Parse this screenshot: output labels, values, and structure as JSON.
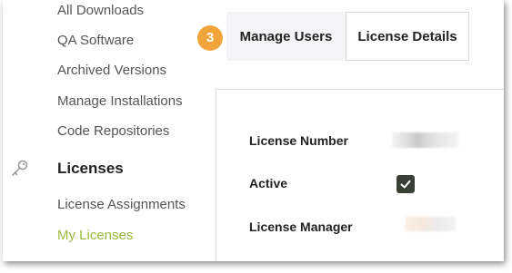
{
  "sidebar": {
    "items": [
      {
        "label": "All Downloads"
      },
      {
        "label": "QA Software"
      },
      {
        "label": "Archived Versions"
      },
      {
        "label": "Manage Installations"
      },
      {
        "label": "Code Repositories"
      }
    ],
    "section": {
      "label": "Licenses",
      "icon": "key-icon"
    },
    "sub_items": [
      {
        "label": "License Assignments"
      },
      {
        "label": "My Licenses",
        "active": true
      }
    ]
  },
  "tabs": {
    "step_number": "3",
    "manage_users": "Manage Users",
    "license_details": "License Details"
  },
  "details": {
    "license_number_label": "License Number",
    "active_label": "Active",
    "active_checked": true,
    "license_manager_label": "License Manager"
  },
  "colors": {
    "accent_active": "#9ab93a",
    "step_badge": "#f0a43a",
    "checkbox_fill": "#3a3f35"
  }
}
